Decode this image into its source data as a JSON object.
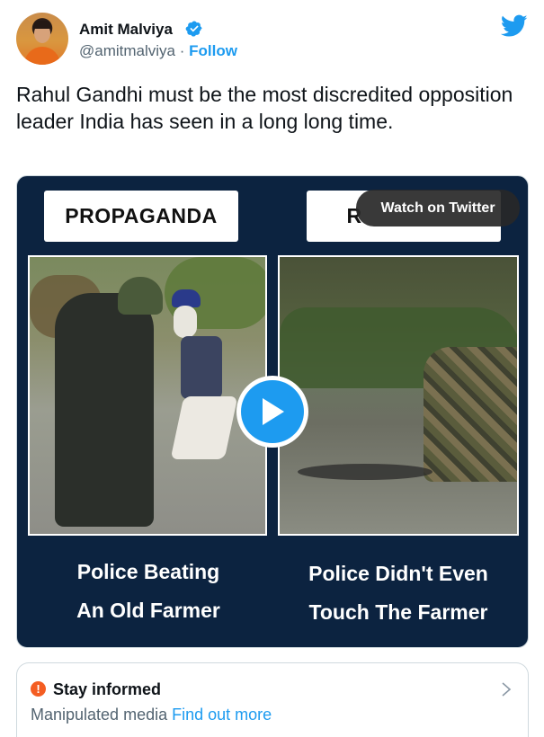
{
  "author": {
    "name": "Amit Malviya",
    "handle": "@amitmalviya",
    "separator": "·",
    "follow_label": "Follow",
    "verified_icon": "verified-badge-icon"
  },
  "tweet": {
    "text": "Rahul Gandhi must be the most discredited opposition leader India has seen in a long long time."
  },
  "media": {
    "left_label": "PROPAGANDA",
    "right_label": "R",
    "watch_label": "Watch on Twitter",
    "left_caption_line1": "Police Beating",
    "left_caption_line2": "An Old Farmer",
    "right_caption_line1": "Police Didn't Even",
    "right_caption_line2": "Touch The Farmer",
    "background_color": "#0c2340"
  },
  "notice": {
    "title": "Stay informed",
    "subtitle": "Manipulated media",
    "link": "Find out more"
  },
  "colors": {
    "accent": "#1d9bf0",
    "warning": "#f45d22"
  }
}
